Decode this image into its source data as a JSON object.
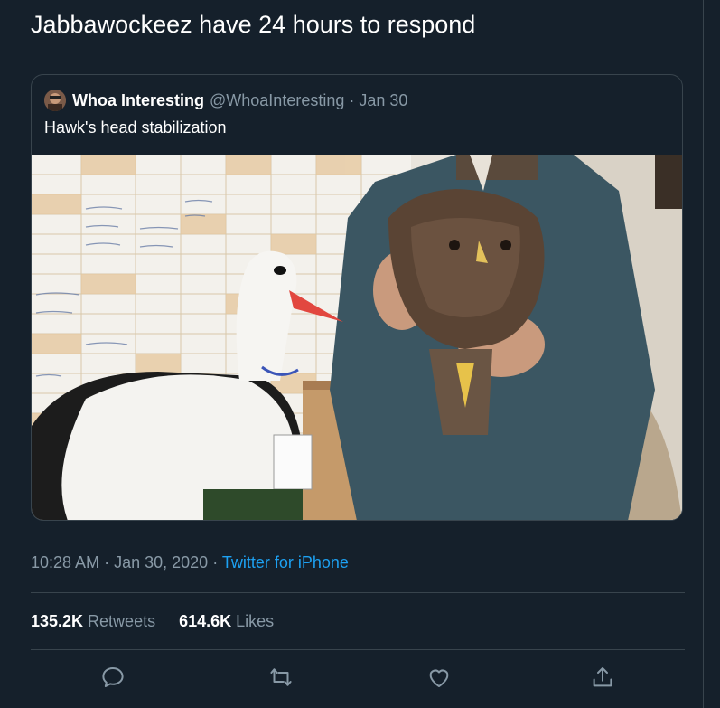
{
  "tweet": {
    "text": "Jabbawockeez have 24 hours to respond"
  },
  "quoted": {
    "name": "Whoa Interesting",
    "handle": "@WhoaInteresting",
    "date": "Jan 30",
    "text": "Hawk's head stabilization",
    "media_description_icon": "video-thumbnail"
  },
  "meta": {
    "time": "10:28 AM",
    "date": "Jan 30, 2020",
    "source": "Twitter for iPhone"
  },
  "stats": {
    "retweets_count": "135.2K",
    "retweets_label": "Retweets",
    "likes_count": "614.6K",
    "likes_label": "Likes"
  },
  "actions": [
    {
      "icon": "reply-icon"
    },
    {
      "icon": "retweet-icon"
    },
    {
      "icon": "like-icon"
    },
    {
      "icon": "share-icon"
    }
  ],
  "colors": {
    "background": "#15202b",
    "border": "#38444d",
    "secondary_text": "#8899a6",
    "link": "#1da1f2"
  }
}
